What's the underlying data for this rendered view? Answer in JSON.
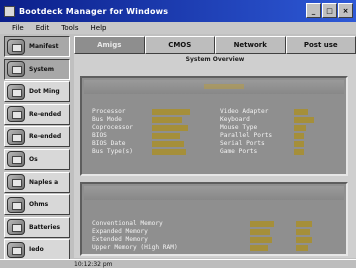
{
  "window": {
    "title": "Bootdeck Manager for Windows",
    "controls": [
      "_",
      "□",
      "×"
    ]
  },
  "menu": [
    "File",
    "Edit",
    "Tools",
    "Help"
  ],
  "sidebar": {
    "items": [
      {
        "label": "Manifest",
        "icon": "manifest-icon",
        "active": true
      },
      {
        "label": "System",
        "icon": "system-icon",
        "active": true
      },
      {
        "label": "Dot Ming",
        "icon": "dot-ming-icon",
        "active": false
      },
      {
        "label": "Re-ended",
        "icon": "device-icon",
        "active": false
      },
      {
        "label": "Re-ended",
        "icon": "device-icon",
        "active": false
      },
      {
        "label": "Os",
        "icon": "os-icon",
        "active": false
      },
      {
        "label": "Naples a",
        "icon": "naples-icon",
        "active": false
      },
      {
        "label": "Ohms",
        "icon": "ohms-icon",
        "active": false
      },
      {
        "label": "Batteries",
        "icon": "battery-icon",
        "active": false
      },
      {
        "label": "Iedo",
        "icon": "info-icon",
        "active": false
      }
    ]
  },
  "tabs": [
    {
      "label": "Amigs",
      "active": true
    },
    {
      "label": "CMOS",
      "active": false
    },
    {
      "label": "Network",
      "active": false
    },
    {
      "label": "Post use",
      "active": false
    }
  ],
  "content": {
    "title": "System Overview",
    "panel1": {
      "left": [
        "Processor",
        "Bus Mode",
        "Coprocessor",
        "BIOS",
        "BIOS Date",
        "Bus Type(s)"
      ],
      "right": [
        "Video Adapter",
        "Keyboard",
        "Mouse Type",
        "Parallel Ports",
        "Serial Ports",
        "Game Ports"
      ]
    },
    "panel2": {
      "rows": [
        "Conventional Memory",
        "Expanded Memory",
        "Extended Memory",
        "Upper Memory (High RAM)"
      ]
    }
  },
  "statusbar": {
    "time": "10:12:32 pm"
  },
  "colors": {
    "titlebar": "#0b1f8a",
    "panel": "#8f8f8f",
    "value": "#a58f3a"
  }
}
